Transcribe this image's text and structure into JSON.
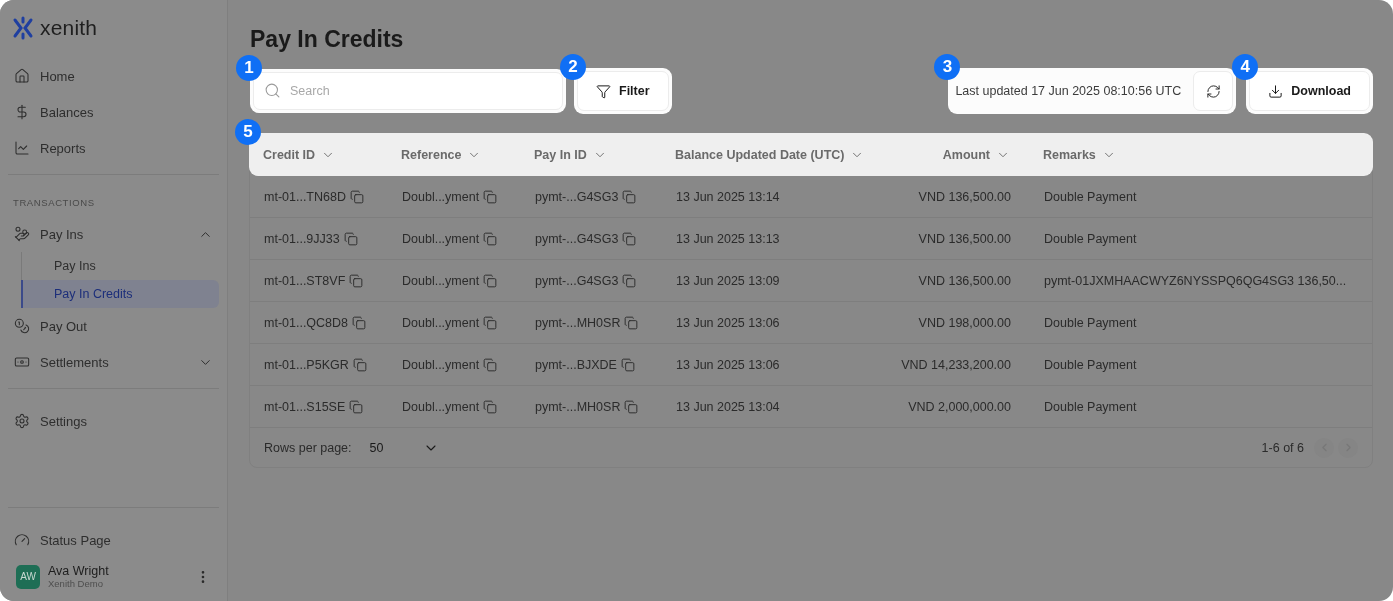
{
  "sidebar": {
    "logo": "xenith",
    "nav": [
      {
        "label": "Home"
      },
      {
        "label": "Balances"
      },
      {
        "label": "Reports"
      }
    ],
    "section_label": "TRANSACTIONS",
    "transactions": [
      {
        "label": "Pay Ins",
        "expanded": true,
        "children": [
          {
            "label": "Pay Ins",
            "selected": false
          },
          {
            "label": "Pay In Credits",
            "selected": true
          }
        ]
      },
      {
        "label": "Pay Out"
      },
      {
        "label": "Settlements",
        "expanded": false
      }
    ],
    "settings": {
      "label": "Settings"
    },
    "status_page": {
      "label": "Status Page"
    },
    "user": {
      "initials": "AW",
      "name": "Ava Wright",
      "org": "Xenith Demo"
    }
  },
  "page": {
    "title": "Pay In Credits",
    "search": {
      "placeholder": "Search"
    },
    "filter_button": "Filter",
    "last_updated": "Last updated 17 Jun 2025 08:10:56 UTC",
    "download_button": "Download",
    "tour_badges": [
      "1",
      "2",
      "3",
      "4",
      "5"
    ],
    "table": {
      "columns": [
        {
          "label": "Credit ID"
        },
        {
          "label": "Reference"
        },
        {
          "label": "Pay In ID"
        },
        {
          "label": "Balance Updated Date (UTC)"
        },
        {
          "label": "Amount"
        },
        {
          "label": "Remarks"
        }
      ],
      "rows": [
        [
          "mt-01...TN68D",
          "Doubl...yment",
          "pymt-...G4SG3",
          "13 Jun 2025 13:14",
          "VND 136,500.00",
          "Double Payment"
        ],
        [
          "mt-01...9JJ33",
          "Doubl...yment",
          "pymt-...G4SG3",
          "13 Jun 2025 13:13",
          "VND 136,500.00",
          "Double Payment"
        ],
        [
          "mt-01...ST8VF",
          "Doubl...yment",
          "pymt-...G4SG3",
          "13 Jun 2025 13:09",
          "VND 136,500.00",
          "pymt-01JXMHAACWYZ6NYSSPQ6QG4SG3 136,50..."
        ],
        [
          "mt-01...QC8D8",
          "Doubl...yment",
          "pymt-...MH0SR",
          "13 Jun 2025 13:06",
          "VND 198,000.00",
          "Double Payment"
        ],
        [
          "mt-01...P5KGR",
          "Doubl...yment",
          "pymt-...BJXDE",
          "13 Jun 2025 13:06",
          "VND 14,233,200.00",
          "Double Payment"
        ],
        [
          "mt-01...S15SE",
          "Doubl...yment",
          "pymt-...MH0SR",
          "13 Jun 2025 13:04",
          "VND 2,000,000.00",
          "Double Payment"
        ]
      ]
    },
    "pagination": {
      "rows_per_page_label": "Rows per page:",
      "rows_per_page": "50",
      "range": "1-6 of 6",
      "prev_disabled": true,
      "next_disabled": true
    }
  }
}
